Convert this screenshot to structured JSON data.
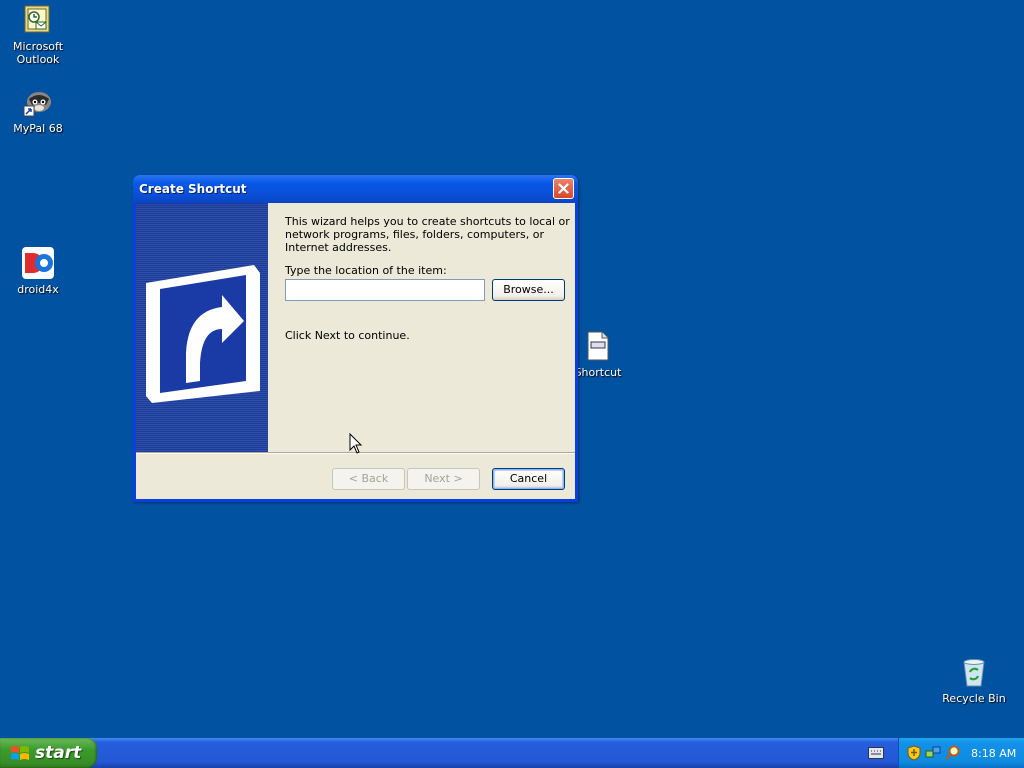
{
  "desktop": {
    "icons": [
      {
        "label": "Microsoft Outlook",
        "icon": "outlook-icon"
      },
      {
        "label": "MyPal 68",
        "icon": "mypal-icon"
      },
      {
        "label": "droid4x",
        "icon": "droid4x-icon"
      },
      {
        "label": "Shortcut",
        "icon": "shortcut-file-icon"
      },
      {
        "label": "Recycle Bin",
        "icon": "recycle-bin-icon"
      }
    ]
  },
  "dialog": {
    "title": "Create Shortcut",
    "intro": "This wizard helps you to create shortcuts to local or network programs, files, folders, computers, or Internet addresses.",
    "location_label": "Type the location of the item:",
    "location_value": "",
    "browse_label": "Browse...",
    "continue_text": "Click Next to continue.",
    "back_label": "< Back",
    "next_label": "Next >",
    "cancel_label": "Cancel"
  },
  "taskbar": {
    "start_label": "start",
    "clock": "8:18 AM"
  },
  "colors": {
    "desktop": "#0152a1",
    "titlebar": "#0a4fd6",
    "dialog_face": "#ece9d8",
    "start_button": "#3c9a2c"
  }
}
